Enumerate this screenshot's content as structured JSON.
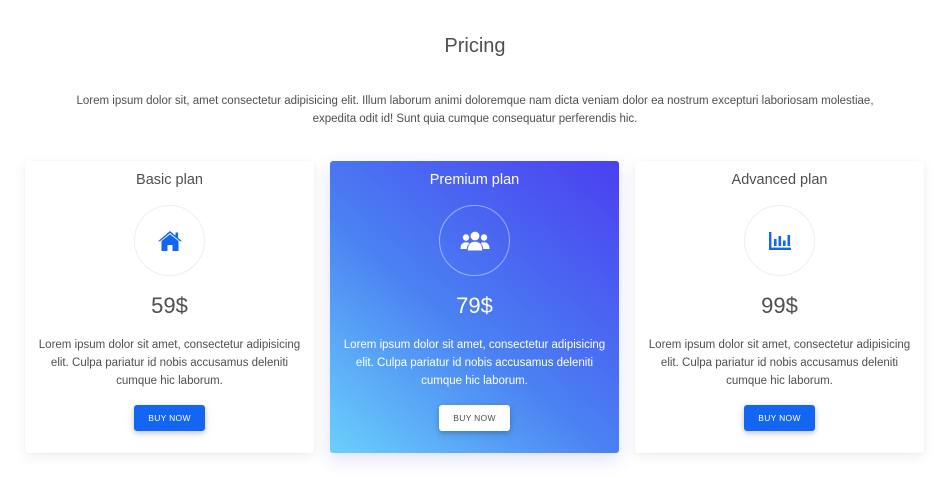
{
  "header": {
    "title": "Pricing",
    "description": "Lorem ipsum dolor sit, amet consectetur adipisicing elit. Illum laborum animi doloremque nam dicta veniam dolor ea nostrum excepturi laboriosam molestiae, expedita odit id! Sunt quia cumque consequatur perferendis hic."
  },
  "colors": {
    "primary": "#1266f1",
    "text": "#4f4f4f",
    "gradient_start": "#6ad0fb",
    "gradient_end": "#4b3ff0"
  },
  "plans": [
    {
      "name": "Basic plan",
      "icon": "home-icon",
      "price": "59$",
      "description": "Lorem ipsum dolor sit amet, consectetur adipisicing elit. Culpa pariatur id nobis accusamus deleniti cumque hic laborum.",
      "button_label": "BUY NOW"
    },
    {
      "name": "Premium plan",
      "icon": "users-icon",
      "price": "79$",
      "description": "Lorem ipsum dolor sit amet, consectetur adipisicing elit. Culpa pariatur id nobis accusamus deleniti cumque hic laborum.",
      "button_label": "BUY NOW"
    },
    {
      "name": "Advanced plan",
      "icon": "chart-bar-icon",
      "price": "99$",
      "description": "Lorem ipsum dolor sit amet, consectetur adipisicing elit. Culpa pariatur id nobis accusamus deleniti cumque hic laborum.",
      "button_label": "BUY NOW"
    }
  ]
}
